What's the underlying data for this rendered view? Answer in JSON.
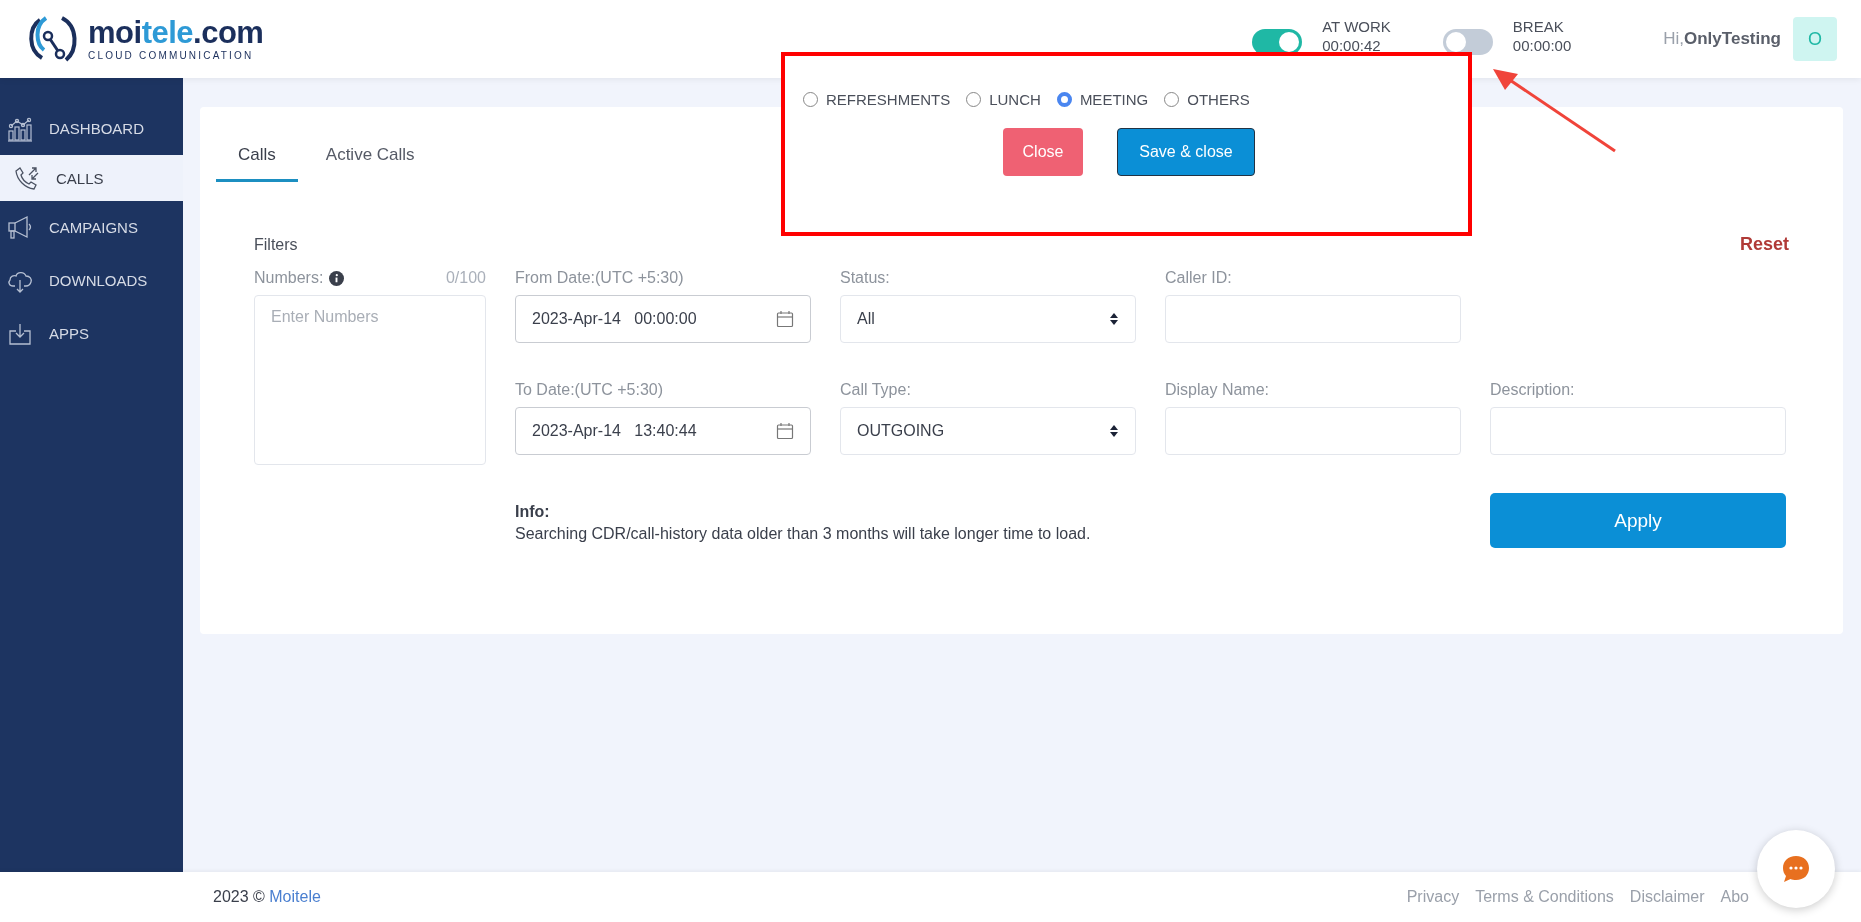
{
  "header": {
    "logo": {
      "name_a": "moi",
      "name_b": "tele",
      "name_c": ".com",
      "tagline": "CLOUD COMMUNICATION"
    },
    "statuses": [
      {
        "label": "AT WORK",
        "time": "00:00:42",
        "on": true
      },
      {
        "label": "BREAK",
        "time": "00:00:00",
        "on": false
      }
    ],
    "greeting": "Hi,",
    "user": "OnlyTesting",
    "avatar": "O"
  },
  "sidebar": {
    "items": [
      {
        "label": "DASHBOARD",
        "kind": "dashboard",
        "selected": false
      },
      {
        "label": "CALLS",
        "kind": "calls",
        "selected": true
      },
      {
        "label": "CAMPAIGNS",
        "kind": "campaigns",
        "selected": false
      },
      {
        "label": "DOWNLOADS",
        "kind": "downloads",
        "selected": false
      },
      {
        "label": "APPS",
        "kind": "apps",
        "selected": false
      }
    ]
  },
  "tabs": [
    {
      "label": "Calls",
      "selected": true
    },
    {
      "label": "Active Calls",
      "selected": false
    }
  ],
  "break_popup": {
    "options": [
      {
        "label": "REFRESHMENTS",
        "selected": false
      },
      {
        "label": "LUNCH",
        "selected": false
      },
      {
        "label": "MEETING",
        "selected": true
      },
      {
        "label": "OTHERS",
        "selected": false
      }
    ],
    "buttons": [
      {
        "label": "Close",
        "kind": "danger"
      },
      {
        "label": "Save & close",
        "kind": "primary"
      }
    ]
  },
  "filters": {
    "title": "Filters",
    "reset": "Reset",
    "numbers": {
      "label": "Numbers:",
      "count": "0/100",
      "placeholder": "Enter Numbers"
    },
    "from_date": {
      "label": "From Date:(UTC +5:30)",
      "value": "2023-Apr-14   00:00:00"
    },
    "status": {
      "label": "Status:",
      "value": "All"
    },
    "caller_id": {
      "label": "Caller ID:"
    },
    "to_date": {
      "label": "To Date:(UTC +5:30)",
      "value": "2023-Apr-14   13:40:44"
    },
    "call_type": {
      "label": "Call Type:",
      "value": "OUTGOING"
    },
    "display_name": {
      "label": "Display Name:"
    },
    "description": {
      "label": "Description:"
    },
    "info_title": "Info:",
    "info_text": "Searching CDR/call-history data older than 3 months will take longer time to load.",
    "apply": "Apply"
  },
  "footer": {
    "year": "2023 ©",
    "brand": "Moitele",
    "links": [
      "Privacy",
      "Terms & Conditions",
      "Disclaimer",
      "Abo"
    ]
  }
}
